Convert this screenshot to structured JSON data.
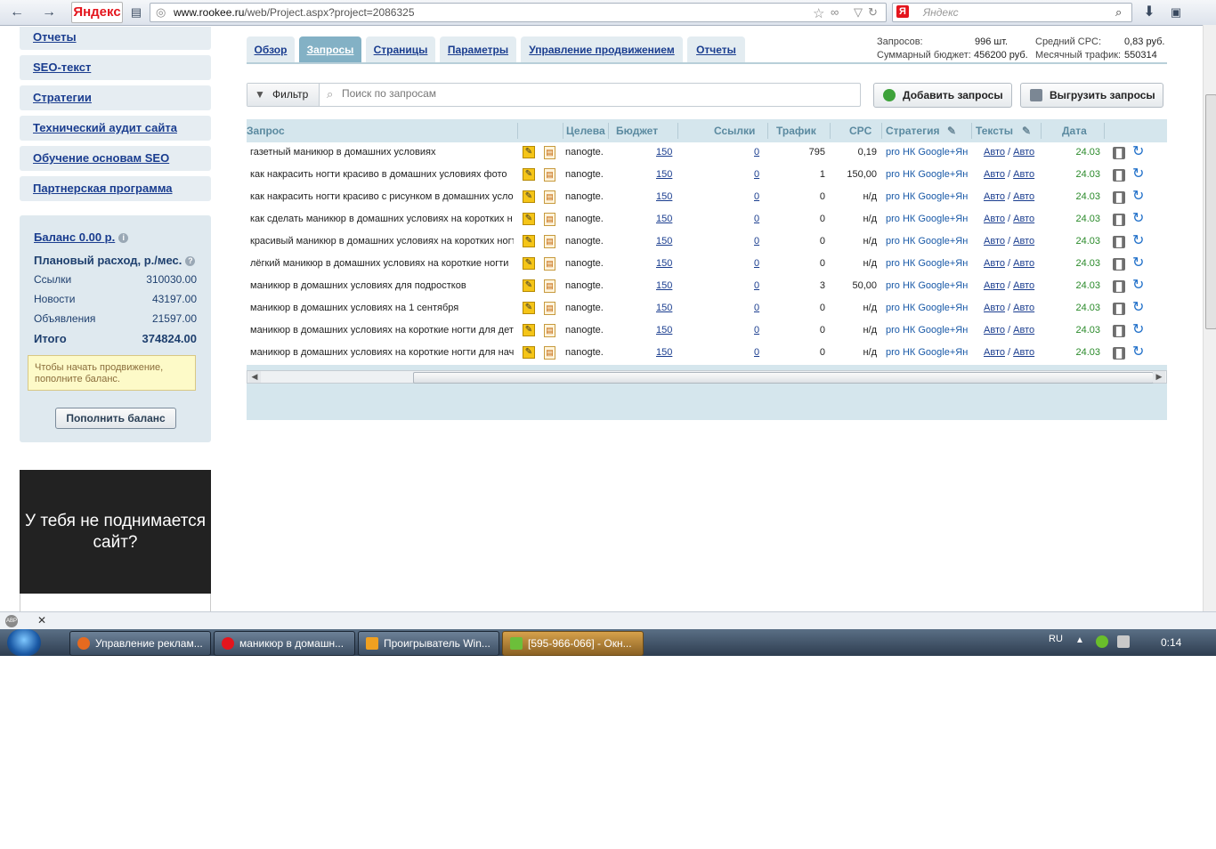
{
  "browser": {
    "logo": "Яндекс",
    "url_host": "www.rookee.ru",
    "url_path": "/web/Project.aspx?project=2086325",
    "search_placeholder": "Яндекс"
  },
  "sidebar": {
    "items": [
      {
        "label": "Отчеты"
      },
      {
        "label": "SEO-текст"
      },
      {
        "label": "Стратегии"
      },
      {
        "label": "Технический аудит сайта"
      },
      {
        "label": "Обучение основам SEO"
      },
      {
        "label": "Партнерская программа"
      }
    ],
    "balance": {
      "title": "Баланс 0.00 р.",
      "plan_title": "Плановый расход, р./мес.",
      "rows": [
        {
          "label": "Ссылки",
          "value": "310030.00"
        },
        {
          "label": "Новости",
          "value": "43197.00"
        },
        {
          "label": "Объявления",
          "value": "21597.00"
        },
        {
          "label": "Итого",
          "value": "374824.00"
        }
      ],
      "warning": "Чтобы начать продвижение, пополните баланс.",
      "topup_label": "Пополнить баланс"
    },
    "ad_text": "У тебя не поднимается сайт?"
  },
  "tabs": [
    {
      "label": "Обзор"
    },
    {
      "label": "Запросы"
    },
    {
      "label": "Страницы"
    },
    {
      "label": "Параметры"
    },
    {
      "label": "Управление продвижением"
    },
    {
      "label": "Отчеты"
    }
  ],
  "stats": {
    "queries_label": "Запросов:",
    "queries_value": "996 шт.",
    "cpc_label": "Средний CPC:",
    "cpc_value": "0,83 руб.",
    "budget_label": "Суммарный бюджет:",
    "budget_value": "456200 руб.",
    "traffic_label": "Месячный трафик:",
    "traffic_value": "550314"
  },
  "toolbar": {
    "filter_label": "Фильтр",
    "search_placeholder": "Поиск по запросам",
    "add_label": "Добавить запросы",
    "export_label": "Выгрузить запросы"
  },
  "grid": {
    "headers": {
      "query": "Запрос",
      "target": "Целева",
      "budget": "Бюджет",
      "links": "Ссылки",
      "traffic": "Трафик",
      "cpc": "CPC",
      "strategy": "Стратегия",
      "texts": "Тексты",
      "date": "Дата"
    },
    "rows": [
      {
        "query": "газетный маникюр в домашних условиях",
        "target": "nanogte.",
        "budget": "150",
        "links": "0",
        "traffic": "795",
        "cpc": "0,19",
        "strategy": "pro НК Google+Ян",
        "text_a": "Авто",
        "text_b": "Авто",
        "date": "24.03"
      },
      {
        "query": "как накрасить ногти красиво в домашних условиях фото",
        "target": "nanogte.",
        "budget": "150",
        "links": "0",
        "traffic": "1",
        "cpc": "150,00",
        "strategy": "pro НК Google+Ян",
        "text_a": "Авто",
        "text_b": "Авто",
        "date": "24.03"
      },
      {
        "query": "как накрасить ногти красиво с рисунком в домашних усло",
        "target": "nanogte.",
        "budget": "150",
        "links": "0",
        "traffic": "0",
        "cpc": "н/д",
        "strategy": "pro НК Google+Ян",
        "text_a": "Авто",
        "text_b": "Авто",
        "date": "24.03"
      },
      {
        "query": "как сделать маникюр в домашних условиях на коротких н",
        "target": "nanogte.",
        "budget": "150",
        "links": "0",
        "traffic": "0",
        "cpc": "н/д",
        "strategy": "pro НК Google+Ян",
        "text_a": "Авто",
        "text_b": "Авто",
        "date": "24.03"
      },
      {
        "query": "красивый маникюр в домашних условиях на коротких ногт",
        "target": "nanogte.",
        "budget": "150",
        "links": "0",
        "traffic": "0",
        "cpc": "н/д",
        "strategy": "pro НК Google+Ян",
        "text_a": "Авто",
        "text_b": "Авто",
        "date": "24.03"
      },
      {
        "query": "лёгкий маникюр в домашних условиях на короткие ногти",
        "target": "nanogte.",
        "budget": "150",
        "links": "0",
        "traffic": "0",
        "cpc": "н/д",
        "strategy": "pro НК Google+Ян",
        "text_a": "Авто",
        "text_b": "Авто",
        "date": "24.03"
      },
      {
        "query": "маникюр в домашних условиях для подростков",
        "target": "nanogte.",
        "budget": "150",
        "links": "0",
        "traffic": "3",
        "cpc": "50,00",
        "strategy": "pro НК Google+Ян",
        "text_a": "Авто",
        "text_b": "Авто",
        "date": "24.03"
      },
      {
        "query": "маникюр в домашних условиях на 1 сентября",
        "target": "nanogte.",
        "budget": "150",
        "links": "0",
        "traffic": "0",
        "cpc": "н/д",
        "strategy": "pro НК Google+Ян",
        "text_a": "Авто",
        "text_b": "Авто",
        "date": "24.03"
      },
      {
        "query": "маникюр в домашних условиях на короткие ногти для дет",
        "target": "nanogte.",
        "budget": "150",
        "links": "0",
        "traffic": "0",
        "cpc": "н/д",
        "strategy": "pro НК Google+Ян",
        "text_a": "Авто",
        "text_b": "Авто",
        "date": "24.03"
      },
      {
        "query": "маникюр в домашних условиях на короткие ногти для нач",
        "target": "nanogte.",
        "budget": "150",
        "links": "0",
        "traffic": "0",
        "cpc": "н/д",
        "strategy": "pro НК Google+Ян",
        "text_a": "Авто",
        "text_b": "Авто",
        "date": "24.03"
      }
    ]
  },
  "taskbar": {
    "tasks": [
      {
        "label": "Управление реклам..."
      },
      {
        "label": "маникюр в домашн..."
      },
      {
        "label": "Проигрыватель Win..."
      },
      {
        "label": "[595-966-066] - Окн..."
      }
    ],
    "lang": "RU",
    "time": "0:14"
  },
  "colors": {
    "tab_active": "#83b1c5",
    "grid_header": "#d5e6ed",
    "link": "#1a3d8f",
    "date_green": "#2a8a2a"
  }
}
